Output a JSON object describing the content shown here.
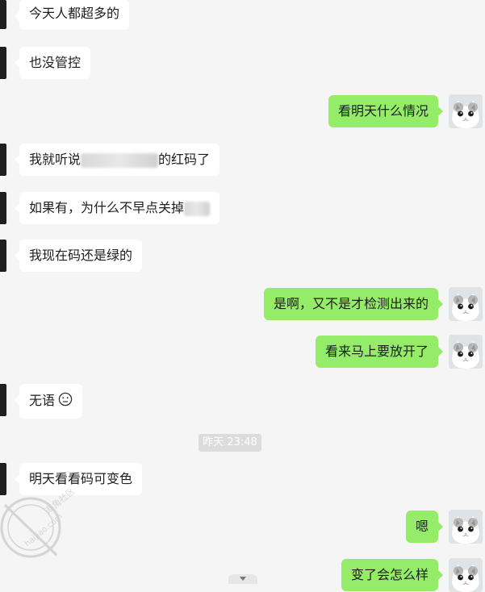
{
  "messages": [
    {
      "side": "in",
      "text": "今天人都超多的"
    },
    {
      "side": "in",
      "text": "也没管控"
    },
    {
      "side": "out",
      "text": "看明天什么情况"
    },
    {
      "side": "in",
      "text_before": "我就听说",
      "text_after": "的红码了"
    },
    {
      "side": "in",
      "text": "如果有，为什么不早点关掉"
    },
    {
      "side": "in",
      "text": "我现在码还是绿的"
    },
    {
      "side": "out",
      "text": "是啊，又不是才检测出来的"
    },
    {
      "side": "out",
      "text": "看来马上要放开了"
    },
    {
      "side": "in",
      "text": "无语"
    },
    {
      "side": "in",
      "text": "明天看看码可变色"
    },
    {
      "side": "out",
      "text": "嗯"
    },
    {
      "side": "out",
      "text": "变了会怎么样"
    }
  ],
  "timestamp": "昨天 23:48",
  "watermark": {
    "line1": "海角社区",
    "line2": "haijiao.com"
  },
  "icons": {
    "avatar": "cat-avatar-icon",
    "emoji": "neutral-face-icon",
    "scroll": "chevron-down-icon"
  },
  "colors": {
    "background": "#f5f5f5",
    "incoming_bubble": "#ffffff",
    "outgoing_bubble": "#95ec69",
    "timestamp_bg": "#dcdcdc"
  }
}
